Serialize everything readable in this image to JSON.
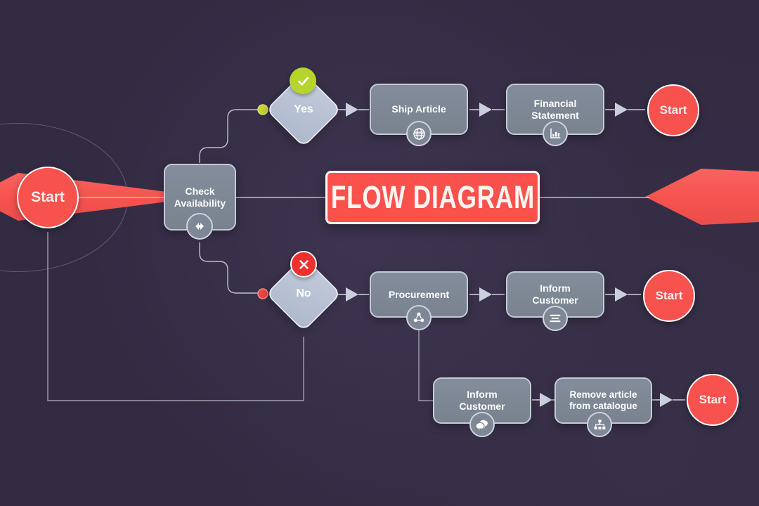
{
  "canvas": {
    "title": "FLOW DIAGRAM",
    "background_color": "#332b42",
    "accent_red": "#f8524e",
    "node_gray": "#7d8694",
    "decision_blue": "#b9c2d4",
    "yes_badge_color": "#b6d42c",
    "no_badge_color": "#f02f2f",
    "connector_color": "#c8ccd6"
  },
  "nodes": {
    "start_left": {
      "label": "Start",
      "shape": "circle",
      "type": "terminator"
    },
    "check_availability": {
      "label_line1": "Check",
      "label_line2": "Availability",
      "shape": "rounded-rect",
      "icon": "arrows-left-right-icon"
    },
    "decision_yes": {
      "label": "Yes",
      "shape": "diamond",
      "badge": "check-circle-icon"
    },
    "decision_no": {
      "label": "No",
      "shape": "diamond",
      "badge": "cross-circle-icon"
    },
    "ship_article": {
      "label": "Ship Article",
      "shape": "rounded-rect",
      "icon": "globe-icon"
    },
    "financial_statement": {
      "label_line1": "Financial",
      "label_line2": "Statement",
      "shape": "rounded-rect",
      "icon": "bar-chart-icon"
    },
    "start_yes_end": {
      "label": "Start",
      "shape": "circle",
      "type": "terminator"
    },
    "procurement": {
      "label": "Procurement",
      "shape": "rounded-rect",
      "icon": "share-nodes-icon"
    },
    "inform_customer_mid": {
      "label_line1": "Inform",
      "label_line2": "Customer",
      "shape": "rounded-rect",
      "icon": "list-lines-icon"
    },
    "start_no_end": {
      "label": "Start",
      "shape": "circle",
      "type": "terminator"
    },
    "inform_customer_bottom": {
      "label_line1": "Inform",
      "label_line2": "Customer",
      "shape": "rounded-rect",
      "icon": "chat-bubbles-icon"
    },
    "remove_article": {
      "label_line1": "Remove article",
      "label_line2": "from catalogue",
      "shape": "rounded-rect",
      "icon": "sitemap-icon"
    },
    "start_bottom_end": {
      "label": "Start",
      "shape": "circle",
      "type": "terminator"
    }
  }
}
